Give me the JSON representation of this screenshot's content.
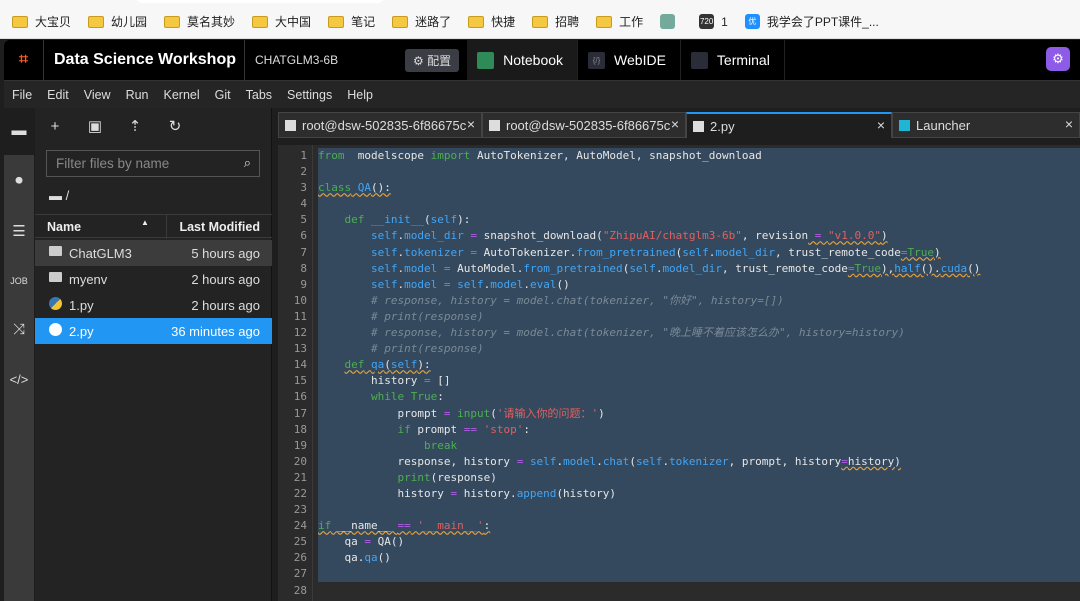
{
  "bookmarks": [
    {
      "label": "大宝贝",
      "icon": "folder-icon"
    },
    {
      "label": "幼儿园",
      "icon": "folder-icon"
    },
    {
      "label": "莫名其妙",
      "icon": "folder-icon"
    },
    {
      "label": "大中国",
      "icon": "folder-icon"
    },
    {
      "label": "笔记",
      "icon": "folder-icon"
    },
    {
      "label": "迷路了",
      "icon": "folder-icon"
    },
    {
      "label": "快捷",
      "icon": "folder-icon"
    },
    {
      "label": "招聘",
      "icon": "folder-icon"
    },
    {
      "label": "工作",
      "icon": "folder-icon"
    },
    {
      "label": "",
      "icon": "openai-icon"
    },
    {
      "label": "1",
      "icon": "720-icon",
      "icon_text": "720"
    },
    {
      "label": "我学会了PPT课件_...",
      "icon": "you-icon",
      "icon_text": "优"
    }
  ],
  "header": {
    "title": "Data Science Workshop",
    "project": "CHATGLM3-6B",
    "config_label": "配置",
    "tabs": [
      "Notebook",
      "WebIDE",
      "Terminal"
    ]
  },
  "menu": [
    "File",
    "Edit",
    "View",
    "Run",
    "Kernel",
    "Git",
    "Tabs",
    "Settings",
    "Help"
  ],
  "files": {
    "filter_placeholder": "Filter files by name",
    "breadcrumb": "/",
    "col_name": "Name",
    "col_modified": "Last Modified",
    "rows": [
      {
        "name": "ChatGLM3",
        "modified": "5 hours ago",
        "type": "folder"
      },
      {
        "name": "myenv",
        "modified": "2 hours ago",
        "type": "folder"
      },
      {
        "name": "1.py",
        "modified": "2 hours ago",
        "type": "python"
      },
      {
        "name": "2.py",
        "modified": "36 minutes ago",
        "type": "python",
        "selected": true
      }
    ]
  },
  "tabs": [
    {
      "label": "root@dsw-502835-6f86675c",
      "icon": "terminal-icon"
    },
    {
      "label": "root@dsw-502835-6f86675c",
      "icon": "terminal-icon"
    },
    {
      "label": "2.py",
      "icon": "file-text-icon",
      "active": true
    },
    {
      "label": "Launcher",
      "icon": "launcher-icon"
    }
  ],
  "code": [
    [
      [
        "kw",
        "from"
      ],
      [
        "",
        "  modelscope "
      ],
      [
        "kw",
        "import"
      ],
      [
        "",
        " AutoTokenizer, AutoModel, snapshot_download"
      ]
    ],
    [],
    [
      [
        "kw wv",
        "class"
      ],
      [
        "wv",
        " "
      ],
      [
        "at wv",
        "QA"
      ],
      [
        "wv",
        "():"
      ]
    ],
    [],
    [
      [
        "",
        "    "
      ],
      [
        "kw",
        "def"
      ],
      [
        "",
        " "
      ],
      [
        "at",
        "__init__"
      ],
      [
        "",
        "("
      ],
      [
        "at",
        "self"
      ],
      [
        "",
        "):"
      ]
    ],
    [
      [
        "",
        "        "
      ],
      [
        "at",
        "self"
      ],
      [
        "",
        "."
      ],
      [
        "at",
        "model_dir"
      ],
      [
        "",
        " "
      ],
      [
        "op",
        "="
      ],
      [
        "",
        " snapshot_download("
      ],
      [
        "st",
        "\"ZhipuAI/chatglm3-6b\""
      ],
      [
        "",
        ", revision"
      ],
      [
        "op wv",
        " = "
      ],
      [
        "st wv",
        "\"v1.0.0\""
      ],
      [
        "wv",
        ")"
      ]
    ],
    [
      [
        "",
        "        "
      ],
      [
        "at",
        "self"
      ],
      [
        "",
        "."
      ],
      [
        "at",
        "tokenizer"
      ],
      [
        "",
        " "
      ],
      [
        "op",
        "="
      ],
      [
        "",
        " AutoTokenizer."
      ],
      [
        "at",
        "from_pretrained"
      ],
      [
        "",
        "("
      ],
      [
        "at",
        "self"
      ],
      [
        "",
        "."
      ],
      [
        "at",
        "model_dir"
      ],
      [
        "",
        ", trust_remote_code"
      ],
      [
        "op wv",
        "="
      ],
      [
        "kw wv",
        "True"
      ],
      [
        "wv",
        ")"
      ]
    ],
    [
      [
        "",
        "        "
      ],
      [
        "at",
        "self"
      ],
      [
        "",
        "."
      ],
      [
        "at",
        "model"
      ],
      [
        "",
        " "
      ],
      [
        "op",
        "="
      ],
      [
        "",
        " AutoModel."
      ],
      [
        "at",
        "from_pretrained"
      ],
      [
        "",
        "("
      ],
      [
        "at",
        "self"
      ],
      [
        "",
        "."
      ],
      [
        "at",
        "model_dir"
      ],
      [
        "",
        ", trust_remote_code"
      ],
      [
        "op wv",
        "="
      ],
      [
        "kw wv",
        "True"
      ],
      [
        "wv",
        "),"
      ],
      [
        "at wv",
        "half"
      ],
      [
        "wv",
        "()."
      ],
      [
        "at wv",
        "cuda"
      ],
      [
        "wv",
        "()"
      ]
    ],
    [
      [
        "",
        "        "
      ],
      [
        "at",
        "self"
      ],
      [
        "",
        "."
      ],
      [
        "at",
        "model"
      ],
      [
        "",
        " "
      ],
      [
        "op",
        "="
      ],
      [
        "",
        " "
      ],
      [
        "at",
        "self"
      ],
      [
        "",
        "."
      ],
      [
        "at",
        "model"
      ],
      [
        "",
        "."
      ],
      [
        "at",
        "eval"
      ],
      [
        "",
        "()"
      ]
    ],
    [
      [
        "",
        "        "
      ],
      [
        "cm",
        "# response, history = model.chat(tokenizer, \"你好\", history=[])"
      ]
    ],
    [
      [
        "",
        "        "
      ],
      [
        "cm",
        "# print(response)"
      ]
    ],
    [
      [
        "",
        "        "
      ],
      [
        "cm",
        "# response, history = model.chat(tokenizer, \"晚上睡不着应该怎么办\", history=history)"
      ]
    ],
    [
      [
        "",
        "        "
      ],
      [
        "cm",
        "# print(response)"
      ]
    ],
    [
      [
        "",
        "    "
      ],
      [
        "kw wv",
        "def"
      ],
      [
        "wv",
        " "
      ],
      [
        "at wv",
        "qa"
      ],
      [
        "wv",
        "("
      ],
      [
        "at wv",
        "self"
      ],
      [
        "wv",
        "):"
      ]
    ],
    [
      [
        "",
        "        history "
      ],
      [
        "op",
        "="
      ],
      [
        "",
        " []"
      ]
    ],
    [
      [
        "",
        "        "
      ],
      [
        "kw",
        "while"
      ],
      [
        "",
        " "
      ],
      [
        "kw",
        "True"
      ],
      [
        "",
        ":"
      ]
    ],
    [
      [
        "",
        "            prompt "
      ],
      [
        "op",
        "="
      ],
      [
        "",
        " "
      ],
      [
        "bi",
        "input"
      ],
      [
        "",
        "("
      ],
      [
        "st",
        "'请输入你的问题：'"
      ],
      [
        "",
        ")"
      ]
    ],
    [
      [
        "",
        "            "
      ],
      [
        "kw",
        "if"
      ],
      [
        "",
        " prompt "
      ],
      [
        "op",
        "=="
      ],
      [
        "",
        " "
      ],
      [
        "st",
        "'stop'"
      ],
      [
        "",
        ":"
      ]
    ],
    [
      [
        "",
        "                "
      ],
      [
        "kw",
        "break"
      ]
    ],
    [
      [
        "",
        "            response, history "
      ],
      [
        "op",
        "="
      ],
      [
        "",
        " "
      ],
      [
        "at",
        "self"
      ],
      [
        "",
        "."
      ],
      [
        "at",
        "model"
      ],
      [
        "",
        "."
      ],
      [
        "at",
        "chat"
      ],
      [
        "",
        "("
      ],
      [
        "at",
        "self"
      ],
      [
        "",
        "."
      ],
      [
        "at",
        "tokenizer"
      ],
      [
        "",
        ", prompt, history"
      ],
      [
        "op wv",
        "="
      ],
      [
        "wv",
        "history)"
      ]
    ],
    [
      [
        "",
        "            "
      ],
      [
        "bi",
        "print"
      ],
      [
        "",
        "(response)"
      ]
    ],
    [
      [
        "",
        "            history "
      ],
      [
        "op",
        "="
      ],
      [
        "",
        " history."
      ],
      [
        "at",
        "append"
      ],
      [
        "",
        "(history)"
      ]
    ],
    [],
    [
      [
        "kw wv",
        "if"
      ],
      [
        "wv",
        " __name__ "
      ],
      [
        "op wv",
        "=="
      ],
      [
        "wv",
        " "
      ],
      [
        "st wv",
        "'__main__'"
      ],
      [
        "wv",
        ":"
      ]
    ],
    [
      [
        "",
        "    qa "
      ],
      [
        "op",
        "="
      ],
      [
        "",
        " QA()"
      ]
    ],
    [
      [
        "",
        "    qa."
      ],
      [
        "at",
        "qa"
      ],
      [
        "",
        "()"
      ]
    ],
    [],
    []
  ],
  "colors": {
    "accent": "#2196f3",
    "selection": "#34495e",
    "avatar": "#8e5be8",
    "logo": "#ff5a1f"
  }
}
